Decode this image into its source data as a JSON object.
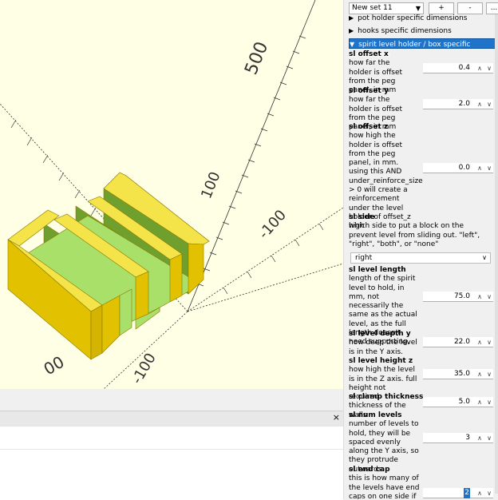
{
  "viewport": {
    "axis_labels": {
      "y500": "500",
      "y100": "100",
      "xn100": "-100",
      "zn100": "-100",
      "y00": "00"
    },
    "colors": {
      "background": "#ffffe5",
      "model_top": "#f5e34a",
      "model_side": "#e2c100",
      "green": "#6fa02e",
      "light_green": "#a9e06a"
    }
  },
  "console": {
    "close_label": "×"
  },
  "customizer": {
    "preset": "New set 11",
    "add_label": "+",
    "remove_label": "-",
    "more_label": "...",
    "groups": {
      "pot": "pot holder specific dimensions",
      "hooks": "hooks specific dimensions",
      "sl": "spirit level holder / box specific dimensions"
    },
    "params": {
      "sl_offset_x": {
        "name": "sl offset x",
        "desc": "how far the holder is offset from the peg panel, in mm",
        "value": "0.4"
      },
      "sl_offset_y": {
        "name": "sl offset y",
        "desc": "how far the holder is offset from the peg panel, in mm",
        "value": "2.0"
      },
      "sl_offset_z": {
        "name": "sl offset z",
        "desc": "how high the holder is offset from the peg panel, in mm. using this AND under_reinforce_size > 0 will create a reinforcement under the level holder of offset_z high",
        "value": "0.0"
      },
      "sl_side": {
        "name": "sl side",
        "desc": "which side to put a block on the prevent level from sliding out. \"left\", \"right\", \"both\", or \"none\"",
        "value": "right"
      },
      "sl_level_length": {
        "name": "sl level length",
        "desc": "length of the spirit level to hold, in mm, not necessarily the same as the actual level, as the full length doesn't need supporting.",
        "value": "75.0"
      },
      "sl_level_depth_y": {
        "name": "sl level depth y",
        "desc": "how deep the level is in the Y axis.",
        "value": "22.0"
      },
      "sl_level_height_z": {
        "name": "sl level height z",
        "desc": "how high the level is in the Z axis. full height not required.",
        "value": "35.0"
      },
      "sl_clamp_thickness": {
        "name": "sl clamp thickness",
        "desc": "thickness of the walls",
        "value": "5.0"
      },
      "sl_num_levels": {
        "name": "sl num levels",
        "desc": "number of levels to hold, they will be spaced evenly along the Y axis, so they protrude outwards.",
        "value": "3"
      },
      "sl_end_cap": {
        "name": "sl end cap",
        "desc": "this is how many of the levels have end caps on one side if side <>",
        "value": "2"
      }
    }
  }
}
